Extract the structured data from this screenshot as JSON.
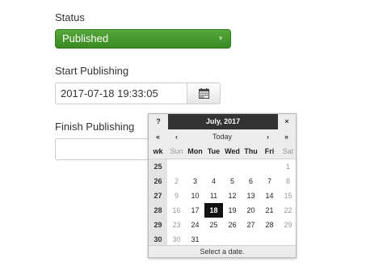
{
  "status": {
    "label": "Status",
    "value": "Published",
    "caret": "▼",
    "color": "#3f9129"
  },
  "start_publishing": {
    "label": "Start Publishing",
    "value": "2017-07-18 19:33:05",
    "button_icon": "calendar-icon"
  },
  "finish_publishing": {
    "label": "Finish Publishing",
    "value": ""
  },
  "calendar": {
    "help": "?",
    "title": "July, 2017",
    "close": "×",
    "nav": {
      "prev_year": "«",
      "prev_month": "‹",
      "today": "Today",
      "next_month": "›",
      "next_year": "»"
    },
    "headers": [
      "wk",
      "Sun",
      "Mon",
      "Tue",
      "Wed",
      "Thu",
      "Fri",
      "Sat"
    ],
    "weeks": [
      {
        "wk": "25",
        "days": [
          "",
          "",
          "",
          "",
          "",
          "",
          "1"
        ]
      },
      {
        "wk": "26",
        "days": [
          "2",
          "3",
          "4",
          "5",
          "6",
          "7",
          "8"
        ]
      },
      {
        "wk": "27",
        "days": [
          "9",
          "10",
          "11",
          "12",
          "13",
          "14",
          "15"
        ]
      },
      {
        "wk": "28",
        "days": [
          "16",
          "17",
          "18",
          "19",
          "20",
          "21",
          "22"
        ]
      },
      {
        "wk": "29",
        "days": [
          "23",
          "24",
          "25",
          "26",
          "27",
          "28",
          "29"
        ]
      },
      {
        "wk": "30",
        "days": [
          "30",
          "31",
          "",
          "",
          "",
          "",
          ""
        ]
      }
    ],
    "selected_day": "18",
    "footer": "Select a date."
  }
}
